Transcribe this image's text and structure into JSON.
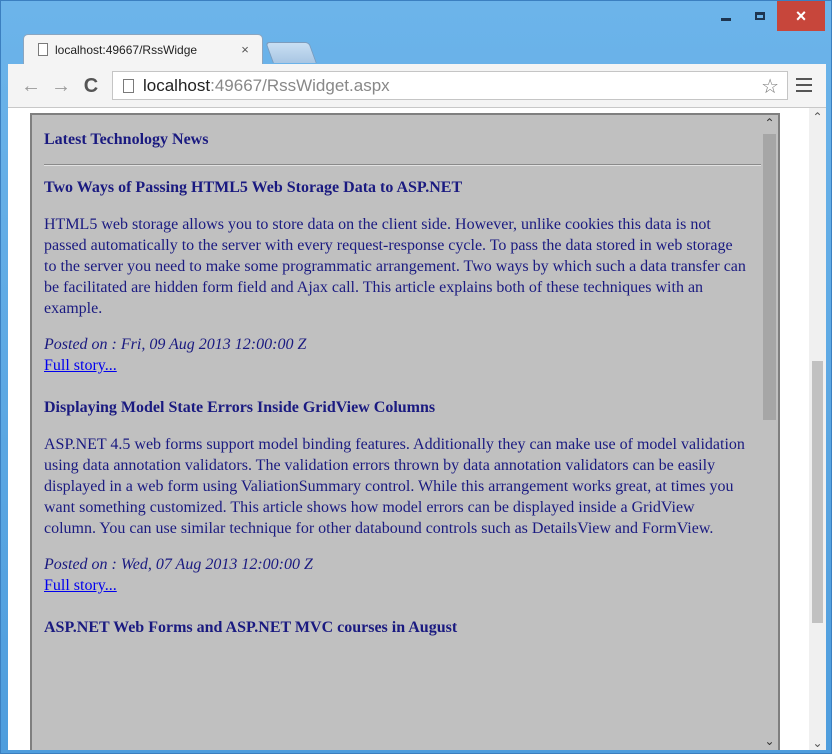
{
  "window": {
    "minimize_glyph": "",
    "close_glyph": "×"
  },
  "tab": {
    "title": "localhost:49667/RssWidge",
    "close_glyph": "×"
  },
  "toolbar": {
    "back_glyph": "←",
    "forward_glyph": "→",
    "reload_glyph": "C",
    "url_host": "localhost",
    "url_rest": ":49667/RssWidget.aspx",
    "star_glyph": "☆"
  },
  "widget": {
    "title": "Latest Technology News",
    "items": [
      {
        "title": "Two Ways of Passing HTML5 Web Storage Data to ASP.NET",
        "description": "HTML5 web storage allows you to store data on the client side. However, unlike cookies this data is not passed automatically to the server with every request-response cycle. To pass the data stored in web storage to the server you need to make some programmatic arrangement. Two ways by which such a data transfer can be facilitated are hidden form field and Ajax call. This article explains both of these techniques with an example.",
        "posted": "Posted on : Fri, 09 Aug 2013 12:00:00 Z",
        "link": "Full story..."
      },
      {
        "title": "Displaying Model State Errors Inside GridView Columns",
        "description": "ASP.NET 4.5 web forms support model binding features. Additionally they can make use of model validation using data annotation validators. The validation errors thrown by data annotation validators can be easily displayed in a web form using ValiationSummary control. While this arrangement works great, at times you want something customized. This article shows how model errors can be displayed inside a GridView column. You can use similar technique for other databound controls such as DetailsView and FormView.",
        "posted": "Posted on : Wed, 07 Aug 2013 12:00:00 Z",
        "link": "Full story..."
      },
      {
        "title": "ASP.NET Web Forms and ASP.NET MVC courses in August"
      }
    ]
  },
  "scrollbars": {
    "up_glyph": "⌃",
    "down_glyph": "⌄"
  }
}
